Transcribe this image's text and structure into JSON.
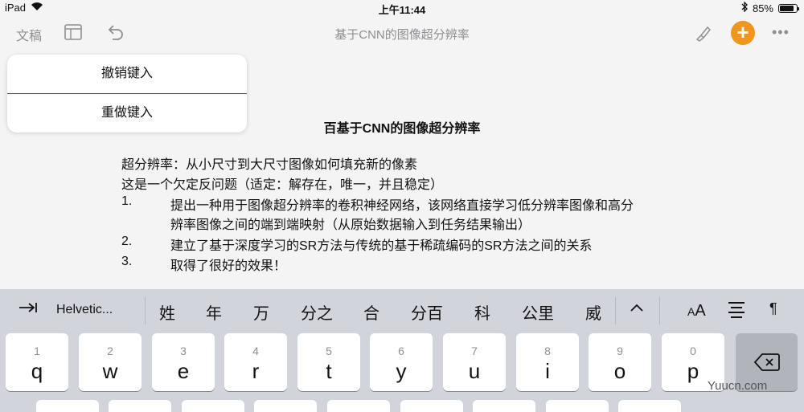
{
  "status": {
    "device": "iPad",
    "time": "上午11:44",
    "battery_text": "85%",
    "battery_level": 0.85
  },
  "toolbar": {
    "documents_label": "文稿",
    "title": "基于CNN的图像超分辨率"
  },
  "popover": {
    "undo_label": "撤销键入",
    "redo_label": "重做键入"
  },
  "document": {
    "heading": "百基于CNN的图像超分辨率",
    "line1": "超分辨率：从小尺寸到大尺寸图像如何填充新的像素",
    "line2": "这是一个欠定反问题（适定：解存在，唯一，并且稳定）",
    "items": [
      {
        "num": "1.",
        "text": "提出一种用于图像超分辨率的卷积神经网络，该网络直接学习低分辨率图像和高分",
        "cont": "辨率图像之间的端到端映射（从原始数据输入到任务结果输出）"
      },
      {
        "num": "2.",
        "text": "建立了基于深度学习的SR方法与传统的基于稀疏编码的SR方法之间的关系"
      },
      {
        "num": "3.",
        "text": "取得了很好的效果！"
      }
    ]
  },
  "keyboard": {
    "font_name": "Helvetic...",
    "candidates": [
      "姓",
      "年",
      "万",
      "分之",
      "合",
      "分百",
      "科",
      "公里",
      "威"
    ],
    "keys": [
      {
        "num": "1",
        "ch": "q"
      },
      {
        "num": "2",
        "ch": "w"
      },
      {
        "num": "3",
        "ch": "e"
      },
      {
        "num": "4",
        "ch": "r"
      },
      {
        "num": "5",
        "ch": "t"
      },
      {
        "num": "6",
        "ch": "y"
      },
      {
        "num": "7",
        "ch": "u"
      },
      {
        "num": "8",
        "ch": "i"
      },
      {
        "num": "9",
        "ch": "o"
      },
      {
        "num": "0",
        "ch": "p"
      }
    ]
  },
  "watermark": "Yuucn.com",
  "colors": {
    "accent": "#f0961d",
    "background": "#f4f4f4",
    "keyboard": "#d1d5db"
  },
  "icons": [
    "wifi-icon",
    "sidebar-icon",
    "undo-icon",
    "brush-icon",
    "plus-icon",
    "more-icon",
    "bluetooth-icon",
    "battery-icon",
    "tab-icon",
    "chevron-up-icon",
    "text-size-icon",
    "align-icon",
    "paragraph-icon",
    "delete-icon"
  ]
}
